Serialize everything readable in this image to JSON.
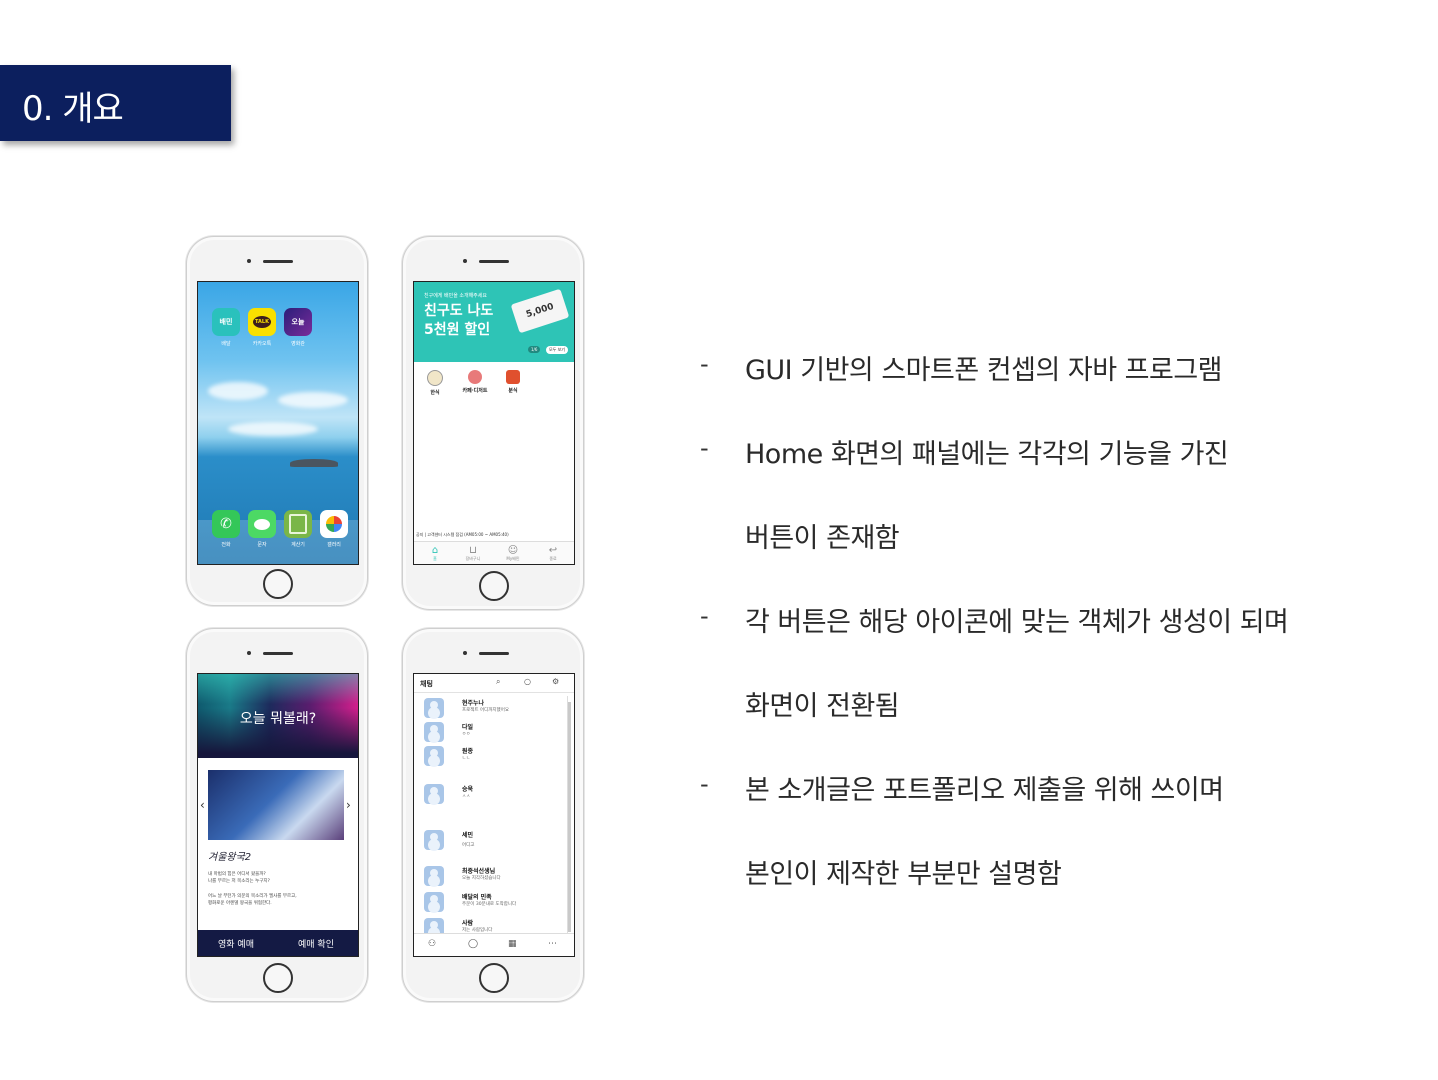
{
  "slide": {
    "title": "0. 개요"
  },
  "phone_home": {
    "apps_top": [
      {
        "label": "배달",
        "icon_text": "배민",
        "color": "#2ac1bc"
      },
      {
        "label": "카카오톡",
        "icon_text": "TALK",
        "color": "#f9e000"
      },
      {
        "label": "영화관",
        "icon_text": "오늘",
        "color": "#3b2a8c"
      }
    ],
    "apps_dock": [
      {
        "label": "전화",
        "color": "#34c759"
      },
      {
        "label": "문자",
        "color": "#4cd964"
      },
      {
        "label": "계산기",
        "color": "#7ab648"
      },
      {
        "label": "갤러리",
        "color": "#ffffff"
      }
    ]
  },
  "phone_delivery": {
    "banner_small": "친구에게 배민을 소개해주세요",
    "banner_big_1": "친구도 나도",
    "banner_big_2": "5천원 할인",
    "coupon": "5,000",
    "pager": "1/6",
    "pager_all": "모두 보기",
    "categories": [
      "한식",
      "카페·디저트",
      "분식"
    ],
    "notice": "공지 | 고객센터 시스템 점검 (AM05:00 ~ AM05:40)",
    "tabs": [
      "홈",
      "장바구니",
      "My배민",
      "종료"
    ]
  },
  "phone_movie": {
    "header": "오늘 뭐볼래?",
    "movie_title": "겨울왕국2",
    "desc_1": "내 마법의 힘은 어디서 왔을까?",
    "desc_2": "나를 부르는 저 목소리는 누구지?",
    "desc_3": "어느 날 부턴가 의문의 목소리가 엘사를 부르고,",
    "desc_4": "평화로운 아렌델 왕국을 위협한다.",
    "bottom_left": "영화 예매",
    "bottom_right": "예매 확인"
  },
  "phone_chat": {
    "title": "채팅",
    "chats": [
      {
        "name": "현주누나",
        "msg": "프로젝트 어디까지했어요"
      },
      {
        "name": "다일",
        "msg": "ㅇㅇ"
      },
      {
        "name": "원종",
        "msg": "ㄴㄴ"
      },
      {
        "name": "승욱",
        "msg": "ㅅㅅ"
      },
      {
        "name": "세민",
        "msg": "어디고"
      },
      {
        "name": "최중석선생님",
        "msg": "오늘 지각하셨습니다"
      },
      {
        "name": "배달의 민족",
        "msg": "주문이 30분내로 도착합니다"
      },
      {
        "name": "사람",
        "msg": "저는 사람입니다"
      }
    ]
  },
  "bullets": [
    {
      "dash": "-",
      "lines": [
        "GUI 기반의 스마트폰 컨셉의 자바 프로그램"
      ]
    },
    {
      "dash": "-",
      "lines": [
        "Home 화면의 패널에는 각각의 기능을 가진",
        "버튼이 존재함"
      ]
    },
    {
      "dash": "-",
      "lines": [
        "각 버튼은 해당 아이콘에 맞는 객체가 생성이 되며",
        "화면이 전환됨"
      ]
    },
    {
      "dash": "-",
      "lines": [
        "본 소개글은 포트폴리오 제출을 위해 쓰이며",
        "본인이 제작한 부분만 설명함"
      ]
    }
  ]
}
